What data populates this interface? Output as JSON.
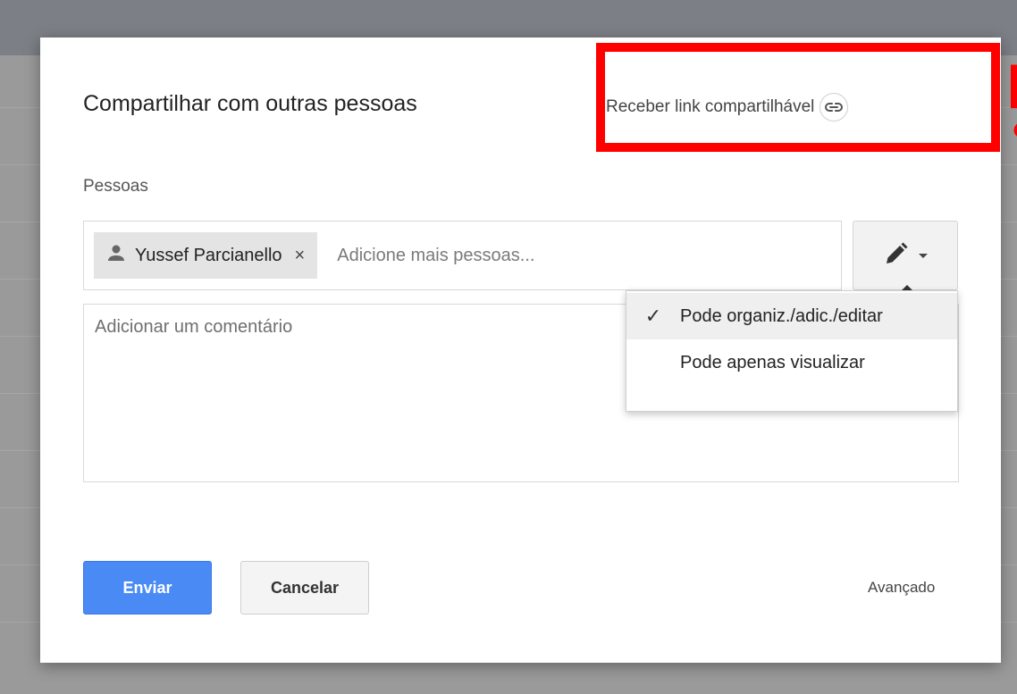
{
  "dialog": {
    "title": "Compartilhar com outras pessoas",
    "share_link_label": "Receber link compartilhável",
    "people_label": "Pessoas",
    "chips": [
      {
        "name": "Yussef Parcianello",
        "remove_symbol": "×"
      }
    ],
    "people_placeholder": "Adicione mais pessoas...",
    "comment_placeholder": "Adicionar um comentário",
    "permission_menu": {
      "items": [
        {
          "label": "Pode organiz./adic./editar",
          "selected": true,
          "check": "✓"
        },
        {
          "label": "Pode apenas visualizar",
          "selected": false,
          "check": ""
        }
      ]
    },
    "send_label": "Enviar",
    "cancel_label": "Cancelar",
    "advanced_label": "Avançado"
  },
  "colors": {
    "primary_button": "#4a8af4",
    "highlight": "#ff0000"
  },
  "icons": {
    "chip_icon": "person-icon",
    "share_link_icon": "link-icon",
    "permission_icon": "pencil-icon",
    "dropdown_icon": "caret-down-icon",
    "check_icon": "checkmark-icon"
  }
}
